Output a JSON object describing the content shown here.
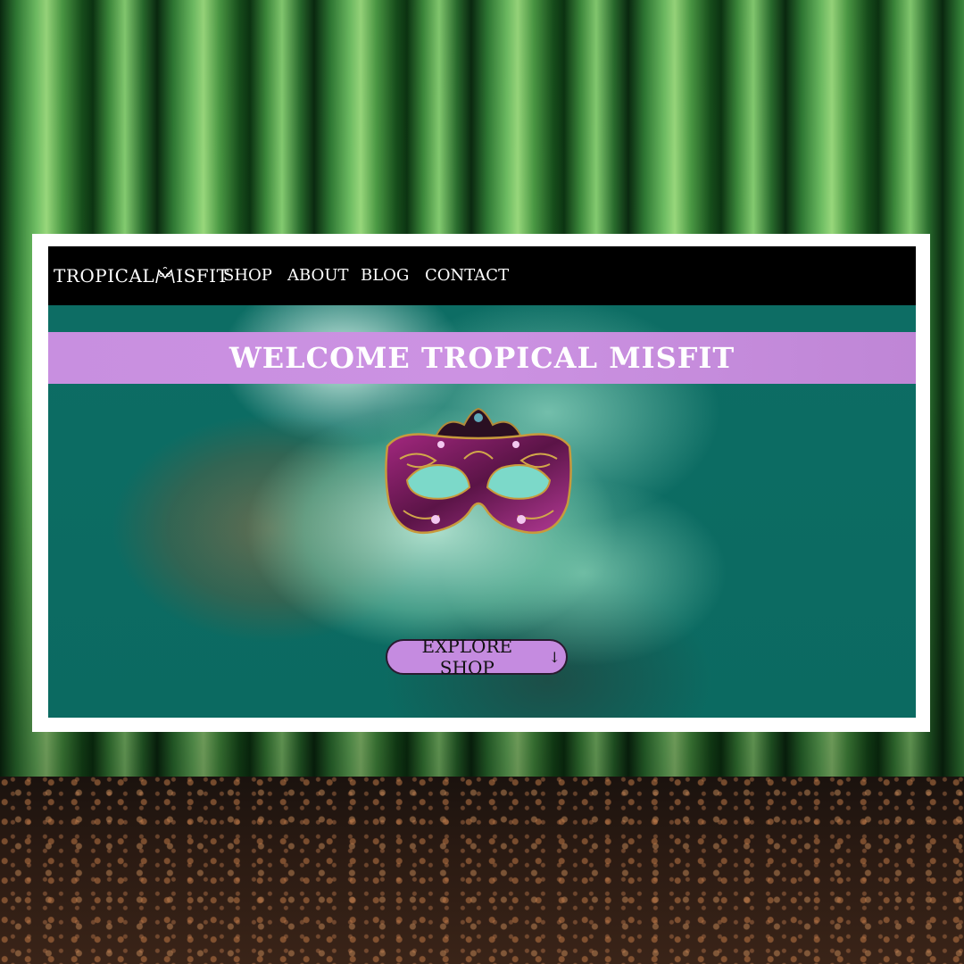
{
  "site": {
    "logo_text_left": "TROPICAL",
    "logo_text_right": "ISFIT",
    "nav": [
      {
        "label": "SHOP"
      },
      {
        "label": "ABOUT"
      },
      {
        "label": "BLOG"
      },
      {
        "label": "CONTACT"
      }
    ],
    "banner_title": "WELCOME TROPICAL MISFIT",
    "cta_label": "EXPLORE SHOP",
    "cta_arrow": "↓"
  },
  "colors": {
    "navbar": "#000000",
    "banner": "#c88fe0",
    "hero_teal": "#0c6b62",
    "cta": "#c58be0"
  },
  "icons": {
    "logo": "mask-m-icon",
    "hero": "masquerade-mask-icon",
    "cta": "arrow-down-icon"
  }
}
